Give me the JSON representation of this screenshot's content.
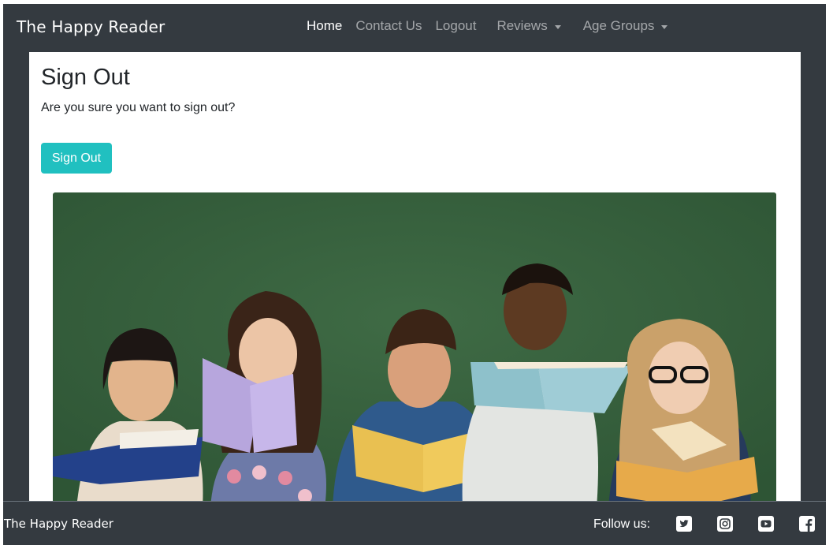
{
  "navbar": {
    "brand": "The Happy Reader",
    "links": [
      {
        "label": "Home",
        "active": true
      },
      {
        "label": "Contact Us"
      },
      {
        "label": "Logout"
      }
    ],
    "dropdowns": [
      {
        "label": "Reviews"
      },
      {
        "label": "Age Groups"
      }
    ]
  },
  "main": {
    "title": "Sign Out",
    "prompt": "Are you sure you want to sign out?",
    "button_label": "Sign Out",
    "hero_image": "children-reading-books"
  },
  "footer": {
    "brand": "The Happy Reader",
    "follow_label": "Follow us:",
    "social": [
      "twitter-icon",
      "instagram-icon",
      "youtube-icon",
      "facebook-icon"
    ]
  },
  "colors": {
    "navbar_bg": "#343a40",
    "button_bg": "#20c0c0",
    "hero_bg": "#355e3b"
  }
}
